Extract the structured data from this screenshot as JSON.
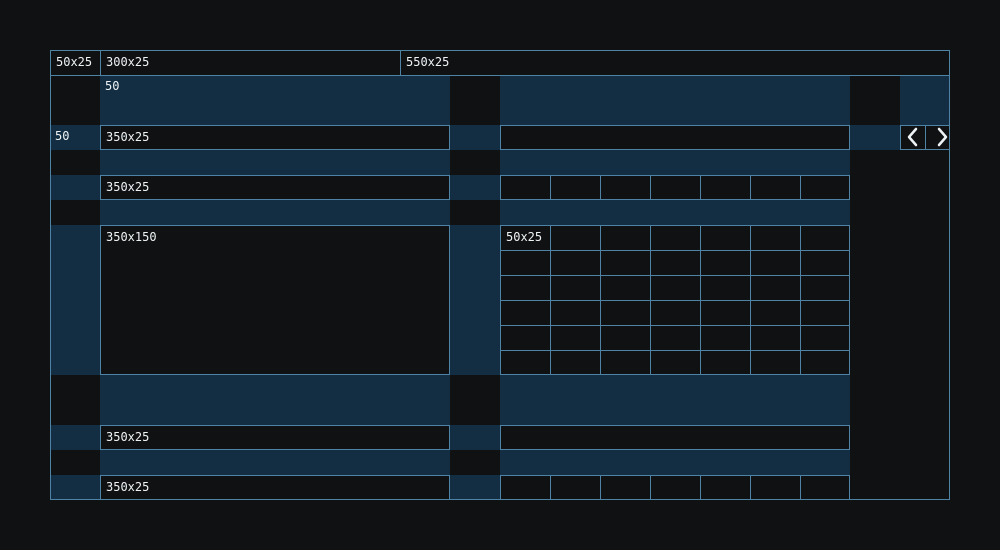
{
  "header": {
    "col_a_label": "50x25",
    "col_b_label": "300x25",
    "col_c_label": "550x25"
  },
  "band_top_label": "50",
  "row_marker_label": "50",
  "left_panels": {
    "row1_label": "350x25",
    "row2_label": "350x25",
    "large_label": "350x150",
    "row4_label": "350x25",
    "row5_label": "350x25"
  },
  "grid": {
    "first_cell_label": "50x25",
    "columns": 7,
    "rows": 6
  },
  "icons": {
    "prev": "chevron-left-icon",
    "next": "chevron-right-icon"
  },
  "colors": {
    "background": "#101112",
    "band_fill": "#132e42",
    "border": "#4e83a6",
    "text": "#eef3f6"
  }
}
